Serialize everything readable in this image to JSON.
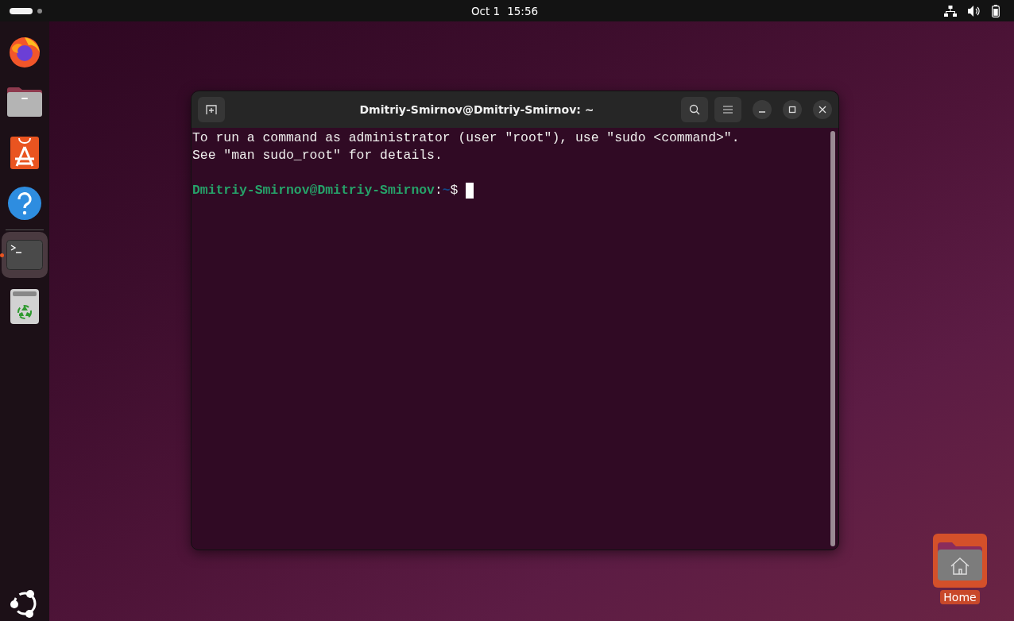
{
  "top_bar": {
    "date": "Oct 1",
    "time": "15:56"
  },
  "dock": {
    "items": [
      {
        "kind": "browser",
        "running": false
      },
      {
        "kind": "files",
        "running": false
      },
      {
        "kind": "store",
        "running": false
      },
      {
        "kind": "help",
        "running": false
      },
      {
        "kind": "terminal",
        "running": true
      },
      {
        "kind": "trash",
        "running": false
      }
    ]
  },
  "terminal": {
    "title": "Dmitriy-Smirnov@Dmitriy-Smirnov: ~",
    "lines": [
      "To run a command as administrator (user \"root\"), use \"sudo <command>\".",
      "See \"man sudo_root\" for details."
    ],
    "prompt": {
      "user_host": "Dmitriy-Smirnov@Dmitriy-Smirnov",
      "separator": ":",
      "path": "~",
      "symbol": "$"
    }
  },
  "desktop_icons": [
    {
      "label": "Home",
      "selected": true
    }
  ]
}
